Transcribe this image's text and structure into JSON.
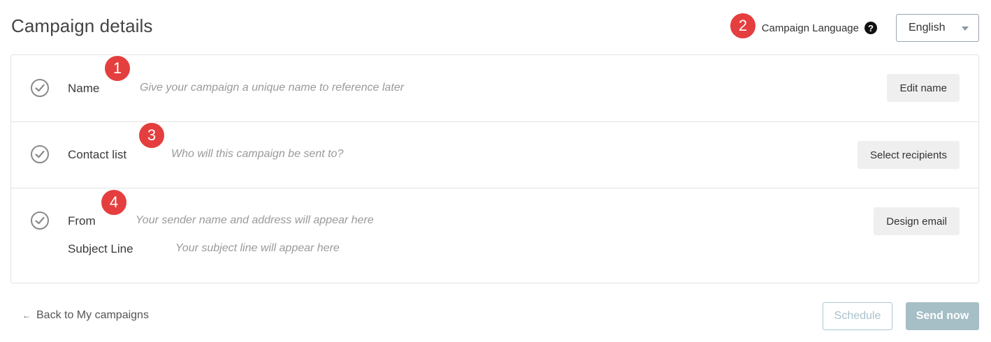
{
  "page": {
    "title": "Campaign details"
  },
  "language": {
    "label": "Campaign Language",
    "help_symbol": "?",
    "selected": "English"
  },
  "annotations": [
    "1",
    "2",
    "3",
    "4"
  ],
  "sections": {
    "name": {
      "label": "Name",
      "hint": "Give your campaign a unique name to reference later",
      "button": "Edit name"
    },
    "contact": {
      "label": "Contact list",
      "hint": "Who will this campaign be sent to?",
      "button": "Select recipients"
    },
    "from": {
      "label": "From",
      "hint": "Your sender name and address will appear here",
      "button": "Design email"
    },
    "subject": {
      "label": "Subject Line",
      "hint": "Your subject line will appear here"
    }
  },
  "footer": {
    "back_arrow": "←",
    "back_label": "Back to My campaigns",
    "schedule_label": "Schedule",
    "send_label": "Send now"
  },
  "colors": {
    "badge": "#e53e3e",
    "send_button": "#a6bec6",
    "schedule_border": "#a9c6cf"
  }
}
